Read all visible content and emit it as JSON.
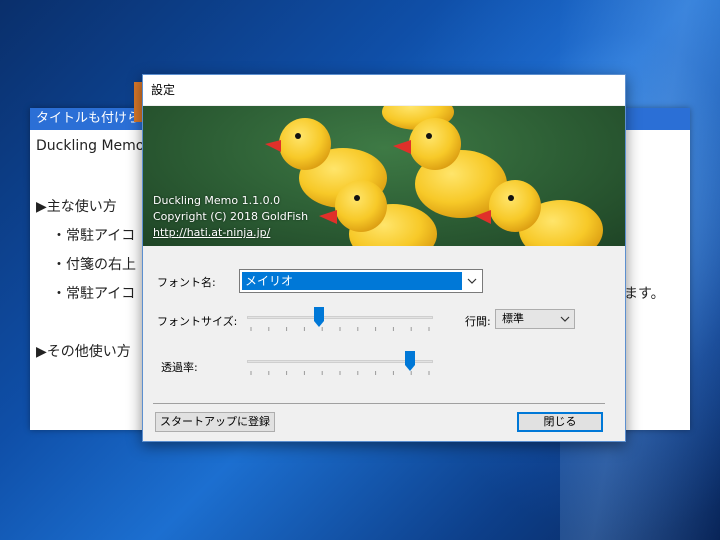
{
  "memo": {
    "title": "タイトルも付けら",
    "lines": [
      "Duckling Memo",
      "▶主な使い方",
      "・常駐アイコ",
      "・付箋の右上",
      "・常駐アイコ",
      "ます。",
      "▶その他使い方"
    ]
  },
  "dialog": {
    "title": "設定",
    "banner": {
      "version": "Duckling Memo 1.1.0.0",
      "copyright": "Copyright (C) 2018 GoldFish",
      "link": "http://hati.at-ninja.jp/"
    },
    "font_name_label": "フォント名:",
    "font_name_value": "メイリオ",
    "font_size_label": "フォントサイズ:",
    "font_size_level": 0.38,
    "line_spacing_label": "行間:",
    "line_spacing_value": "標準",
    "transparency_label": "透過率:",
    "transparency_level": 0.9,
    "startup_button": "スタートアップに登録",
    "close_button": "閉じる"
  },
  "colors": {
    "accent": "#0078d7",
    "memo_titlebar": "#2b6fd6",
    "duck_yellow": "#f7c928",
    "duck_beak": "#e0302a"
  }
}
